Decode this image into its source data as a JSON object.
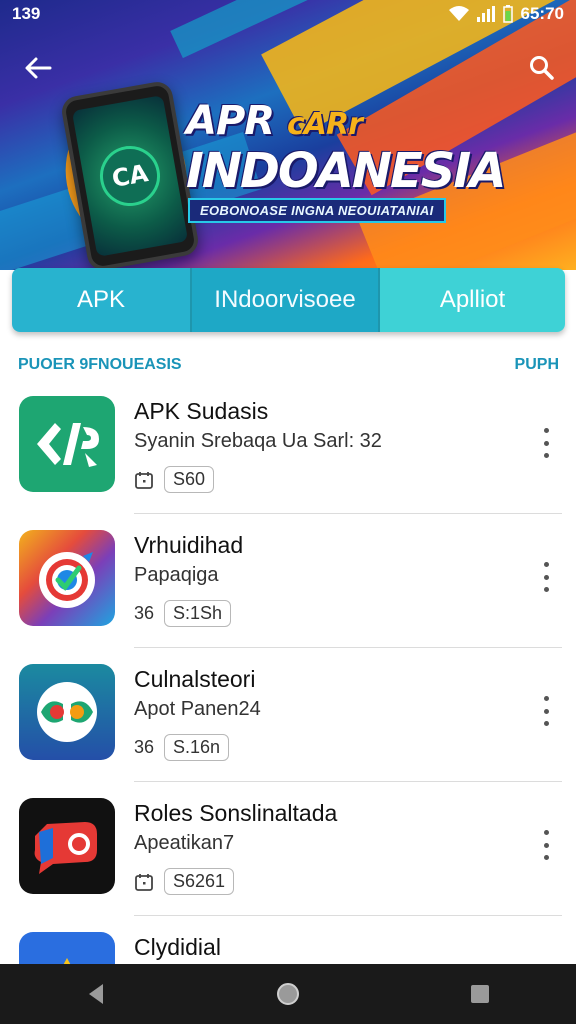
{
  "status_bar": {
    "time_left": "139",
    "time_right": "65:70"
  },
  "hero": {
    "title_line1": "APR",
    "title_accent": "cARr",
    "title_line2": "INDOANESIA",
    "banner": "EOBONOASE INGNA NEOUIATANIAI",
    "phone_logo": "CA"
  },
  "tabs": [
    {
      "label": "APK"
    },
    {
      "label": "INdoorvisoee"
    },
    {
      "label": "Aplliot"
    }
  ],
  "section": {
    "title": "PUOER 9FNOUEASIS",
    "action": "PUPH"
  },
  "apps": [
    {
      "title": "APK Sudasis",
      "subtitle": "Syanin Srebaqa Ua Sarl: 32",
      "meta_text": "",
      "chip": "S60",
      "meta_icon": "calendar-icon",
      "icon": "app-logo-apk-icon"
    },
    {
      "title": "Vrhuidihad",
      "subtitle": "Papaqiga",
      "meta_text": "36",
      "chip": "S:1Sh",
      "meta_icon": "",
      "icon": "app-logo-target-icon"
    },
    {
      "title": "Culnalsteori",
      "subtitle": "Apot Panen24",
      "meta_text": "36",
      "chip": "S.16n",
      "meta_icon": "",
      "icon": "app-logo-circle-icon"
    },
    {
      "title": "Roles Sonslinaltada",
      "subtitle": "Apeatikan7",
      "meta_text": "",
      "chip": "S6261",
      "meta_icon": "calendar-icon",
      "icon": "app-logo-chat-icon"
    },
    {
      "title": "Clydidial",
      "subtitle": "",
      "meta_text": "",
      "chip": "",
      "meta_icon": "",
      "icon": "app-logo-triangle-icon"
    }
  ],
  "colors": {
    "accent": "#1a94b8",
    "tab_primary": "#28b3cf",
    "tab_light": "#3ed2d6"
  }
}
